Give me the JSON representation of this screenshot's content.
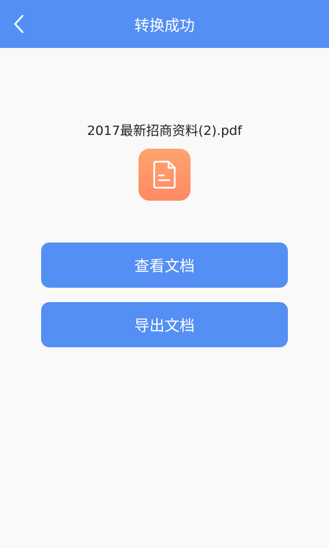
{
  "header": {
    "title": "转换成功",
    "back_icon": "chevron-left-icon"
  },
  "file": {
    "name": "2017最新招商资料(2).pdf",
    "icon": "document-icon",
    "icon_gradient": [
      "#ffa36f",
      "#ff8a63"
    ]
  },
  "actions": {
    "view_label": "查看文档",
    "export_label": "导出文档"
  },
  "colors": {
    "primary": "#548ff4",
    "background": "#f9f9f9",
    "text": "#222222"
  }
}
